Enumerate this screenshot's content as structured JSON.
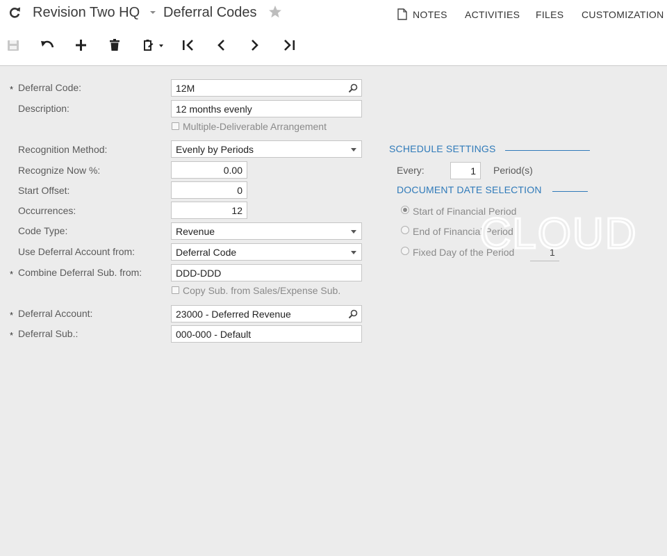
{
  "header": {
    "company": "Revision Two HQ",
    "screen_title": "Deferral Codes",
    "links": {
      "notes": "NOTES",
      "activities": "ACTIVITIES",
      "files": "FILES",
      "customization": "CUSTOMIZATION"
    }
  },
  "form": {
    "deferral_code": {
      "label": "Deferral Code:",
      "value": "12M"
    },
    "description": {
      "label": "Description:",
      "value": "12 months evenly"
    },
    "mda": {
      "label": "Multiple-Deliverable Arrangement"
    },
    "recognition_method": {
      "label": "Recognition Method:",
      "value": "Evenly by Periods"
    },
    "recognize_now": {
      "label": "Recognize Now %:",
      "value": "0.00"
    },
    "start_offset": {
      "label": "Start Offset:",
      "value": "0"
    },
    "occurrences": {
      "label": "Occurrences:",
      "value": "12"
    },
    "code_type": {
      "label": "Code Type:",
      "value": "Revenue"
    },
    "use_deferral_account": {
      "label": "Use Deferral Account from:",
      "value": "Deferral Code"
    },
    "combine_sub": {
      "label": "Combine Deferral Sub. from:",
      "value": "DDD-DDD"
    },
    "copy_sub": {
      "label": "Copy Sub. from Sales/Expense Sub."
    },
    "deferral_account": {
      "label": "Deferral Account:",
      "value": "23000 - Deferred Revenue"
    },
    "deferral_sub": {
      "label": "Deferral Sub.:",
      "value": "000-000 - Default"
    }
  },
  "schedule": {
    "title": "SCHEDULE SETTINGS",
    "every_label": "Every:",
    "every_value": "1",
    "periods_label": "Period(s)"
  },
  "date_selection": {
    "title": "DOCUMENT DATE SELECTION",
    "options": [
      "Start of Financial Period",
      "End of Financial Period",
      "Fixed Day of the Period"
    ],
    "selected_index": 0,
    "fixed_day_value": "1"
  },
  "watermark_text": "CLOUD",
  "required_mark": "*"
}
